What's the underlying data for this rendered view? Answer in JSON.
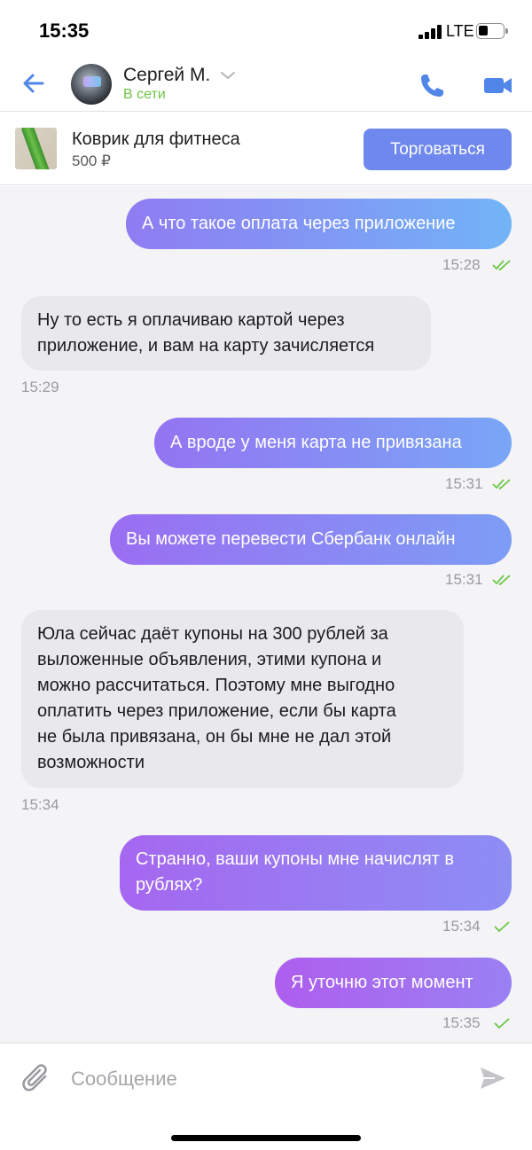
{
  "status_bar": {
    "time": "15:35",
    "network": "LTE"
  },
  "header": {
    "contact_name": "Сергей М.",
    "contact_status": "В сети",
    "status_color": "#6dc545",
    "icons": [
      "back-arrow-icon",
      "chevron-down-icon",
      "phone-icon",
      "video-camera-icon"
    ]
  },
  "product": {
    "title": "Коврик для фитнеса",
    "price": "500 ₽",
    "trade_label": "Торговаться",
    "accent_color": "#6f88ee"
  },
  "messages": [
    {
      "direction": "outgoing",
      "text": "А что такое оплата через приложение",
      "time": "15:28",
      "read": true
    },
    {
      "direction": "incoming",
      "text": "Ну то есть я оплачиваю картой через\nприложение, и вам на карту зачисляется",
      "time": "15:29"
    },
    {
      "direction": "outgoing",
      "text": "А вроде у меня карта не привязана",
      "time": "15:31",
      "read": true
    },
    {
      "direction": "outgoing",
      "text": "Вы можете перевести Сбербанк онлайн",
      "time": "15:31",
      "read": true
    },
    {
      "direction": "incoming",
      "text": "Юла сейчас даёт купоны на 300 рублей за\nвыложенные объявления, этими купона и\nможно рассчитаться. Поэтому мне выгодно\nоплатить через приложение, если бы карта\nне была привязана, он бы мне не дал этой\nвозможности",
      "time": "15:34"
    },
    {
      "direction": "outgoing",
      "text": "Странно, ваши купоны мне начислят в\nрублях?",
      "time": "15:34",
      "read": false
    },
    {
      "direction": "outgoing",
      "text": "Я уточню этот момент",
      "time": "15:35",
      "read": false
    }
  ],
  "composer": {
    "placeholder": "Сообщение",
    "icons": [
      "paperclip-icon",
      "send-icon"
    ]
  }
}
